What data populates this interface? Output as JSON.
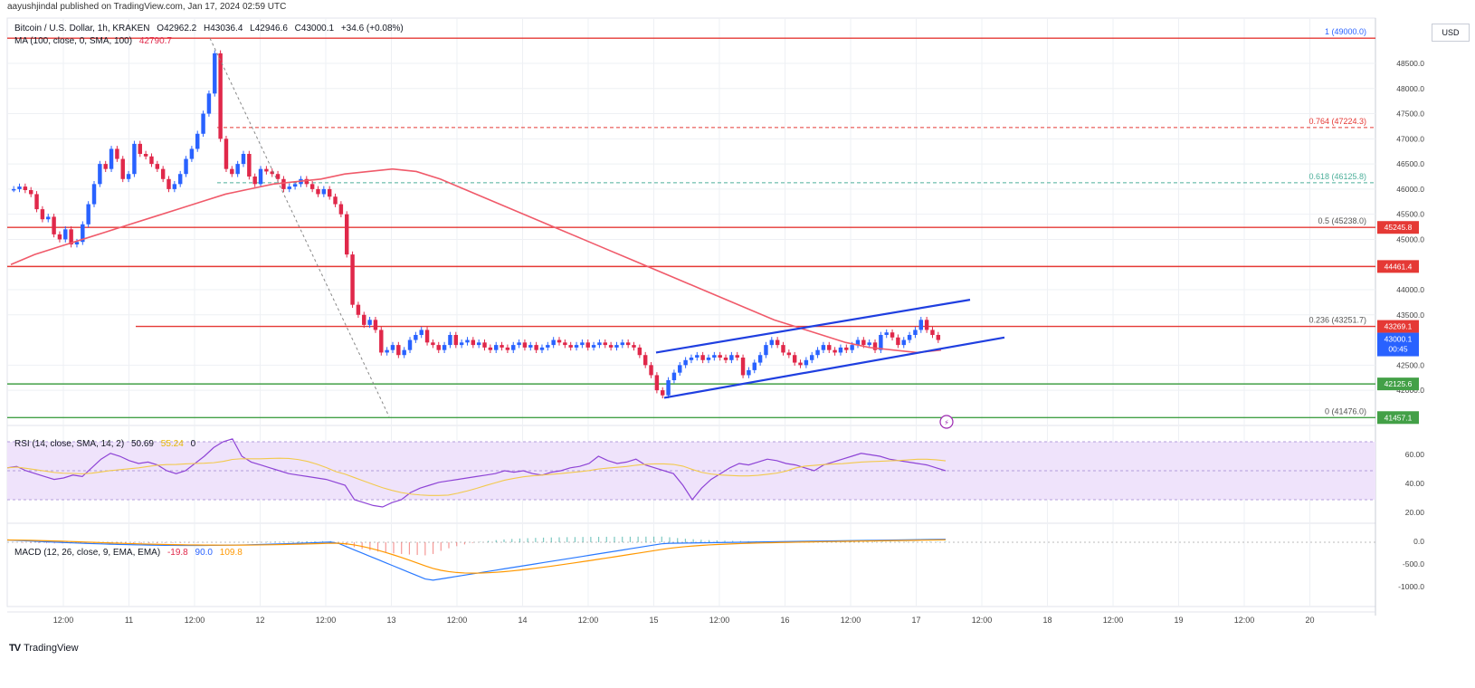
{
  "header": {
    "publish_text": "aayushjindal published on TradingView.com, Jan 17, 2024 02:59 UTC",
    "symbol_line": {
      "name": "Bitcoin / U.S. Dollar, 1h, KRAKEN",
      "open": "O42962.2",
      "high": "H43036.4",
      "low": "L42946.6",
      "close": "C43000.1",
      "change": "+34.6 (+0.08%)"
    },
    "ma_line": {
      "label": "MA (100, close, 0, SMA, 100)",
      "value": "42790.7"
    }
  },
  "currency_button": "USD",
  "brand": {
    "logo": "TV",
    "name": "TradingView"
  },
  "colors": {
    "up": "#2962ff",
    "down": "#e0284a",
    "ma": "#f05a6a",
    "resistance": "#e53935",
    "support": "#43a047",
    "channel": "#1f3fe0",
    "rsi_band": "#efe3fb",
    "rsi_line": "#8e44d6",
    "rsi_ma": "#f2c94c",
    "macd_line": "#2979ff",
    "signal_line": "#ff9800"
  },
  "chart_data": {
    "type": "candlestick",
    "price_axis": {
      "ylim": [
        41300,
        49400
      ],
      "ticks": [
        "48500.0",
        "48000.0",
        "47500.0",
        "47000.0",
        "46500.0",
        "46000.0",
        "45500.0",
        "45000.0",
        "44000.0",
        "43500.0",
        "42500.0",
        "42000.0"
      ]
    },
    "time_axis": [
      "12:00",
      "11",
      "12:00",
      "12",
      "12:00",
      "13",
      "12:00",
      "14",
      "12:00",
      "15",
      "12:00",
      "16",
      "12:00",
      "17",
      "12:00",
      "18",
      "12:00",
      "19",
      "12:00",
      "20"
    ],
    "closes": [
      46000,
      46050,
      45980,
      45900,
      45600,
      45400,
      45450,
      45100,
      45000,
      45200,
      44900,
      44950,
      45300,
      45700,
      46100,
      46500,
      46400,
      46800,
      46600,
      46200,
      46300,
      46900,
      46700,
      46650,
      46500,
      46400,
      46200,
      46000,
      46100,
      46300,
      46600,
      46800,
      47100,
      47500,
      47900,
      48700,
      47000,
      46400,
      46300,
      46500,
      46700,
      46250,
      46100,
      46400,
      46350,
      46300,
      46200,
      46000,
      46050,
      46100,
      46200,
      46100,
      46000,
      45900,
      46000,
      45850,
      45700,
      45500,
      44700,
      43700,
      43500,
      43300,
      43400,
      43200,
      42750,
      42800,
      42900,
      42700,
      42800,
      43000,
      43100,
      43200,
      42950,
      42900,
      42800,
      42900,
      43100,
      42900,
      42950,
      43000,
      42900,
      42950,
      42850,
      42800,
      42900,
      42850,
      42800,
      42900,
      42950,
      42850,
      42900,
      42800,
      42850,
      42900,
      43000,
      42950,
      42900,
      42850,
      42900,
      42950,
      42850,
      42900,
      42950,
      42900,
      42850,
      42900,
      42950,
      42900,
      42850,
      42700,
      42500,
      42300,
      42000,
      41900,
      42200,
      42350,
      42500,
      42600,
      42650,
      42700,
      42600,
      42650,
      42700,
      42650,
      42600,
      42700,
      42650,
      42300,
      42400,
      42550,
      42700,
      42900,
      43000,
      42900,
      42750,
      42700,
      42550,
      42500,
      42600,
      42700,
      42800,
      42900,
      42800,
      42750,
      42850,
      42800,
      42900,
      43000,
      42900,
      42950,
      42800,
      43100,
      43150,
      43050,
      42900,
      43000,
      43100,
      43200,
      43400,
      43200,
      43100,
      43000
    ],
    "ma_values": [
      44500,
      44700,
      44850,
      45000,
      45150,
      45300,
      45450,
      45600,
      45750,
      45900,
      46000,
      46100,
      46150,
      46200,
      46300,
      46350,
      46400,
      46350,
      46200,
      46000,
      45800,
      45600,
      45400,
      45200,
      45000,
      44800,
      44600,
      44400,
      44200,
      44000,
      43800,
      43600,
      43400,
      43250,
      43100,
      42950,
      42850,
      42800,
      42750,
      42800
    ],
    "horizontal_levels": [
      {
        "kind": "resistance",
        "price": 49000,
        "label": "1 (49000.0)"
      },
      {
        "kind": "fib",
        "price": 47224.3,
        "label": "0.764 (47224.3)"
      },
      {
        "kind": "fib",
        "price": 46125.8,
        "label": "0.618 (46125.8)"
      },
      {
        "kind": "resistance",
        "price": 45238,
        "label": "0.5 (45238.0)",
        "tag": "45245.8"
      },
      {
        "kind": "resistance",
        "price": 44461.4,
        "tag": "44461.4"
      },
      {
        "kind": "resistance",
        "price": 43269.1,
        "label": "0.236 (43251.7)",
        "tag": "43269.1"
      },
      {
        "kind": "support",
        "price": 42125.6,
        "tag": "42125.6"
      },
      {
        "kind": "support",
        "price": 41457.1,
        "label": "0 (41476.0)",
        "tag": "41457.1"
      }
    ],
    "current_price": {
      "value": "43000.1",
      "countdown": "00:45"
    },
    "channel": {
      "upper": [
        [
          42750,
          43000
        ],
        [
          43800,
          43000
        ]
      ],
      "lower": [
        [
          41850,
          42750
        ],
        [
          43050,
          42750
        ]
      ]
    },
    "rsi": {
      "label": "RSI (14, close, SMA, 14, 2)",
      "value": "50.69",
      "ma_value": "55.24",
      "extra": "0",
      "ticks": [
        "60.00",
        "40.00",
        "20.00"
      ],
      "values": [
        52,
        53,
        50,
        48,
        46,
        44,
        45,
        47,
        46,
        52,
        58,
        62,
        60,
        57,
        55,
        56,
        54,
        50,
        48,
        50,
        55,
        60,
        66,
        70,
        72,
        60,
        56,
        54,
        52,
        50,
        48,
        47,
        46,
        45,
        44,
        42,
        40,
        30,
        28,
        26,
        25,
        28,
        30,
        35,
        38,
        40,
        42,
        43,
        44,
        45,
        46,
        47,
        48,
        50,
        49,
        50,
        48,
        47,
        49,
        50,
        52,
        53,
        55,
        60,
        57,
        55,
        56,
        58,
        54,
        52,
        50,
        48,
        40,
        30,
        38,
        44,
        48,
        52,
        55,
        54,
        56,
        58,
        57,
        55,
        54,
        52,
        50,
        54,
        56,
        58,
        60,
        62,
        61,
        60,
        58,
        57,
        56,
        55,
        54,
        52,
        50
      ]
    },
    "macd": {
      "label": "MACD (12, 26, close, 9, EMA, EMA)",
      "macd_value": "-19.8",
      "signal_value": "90.0",
      "hist_value": "109.8",
      "ticks": [
        "0.0",
        "-500.0",
        "-1000.0"
      ]
    }
  }
}
